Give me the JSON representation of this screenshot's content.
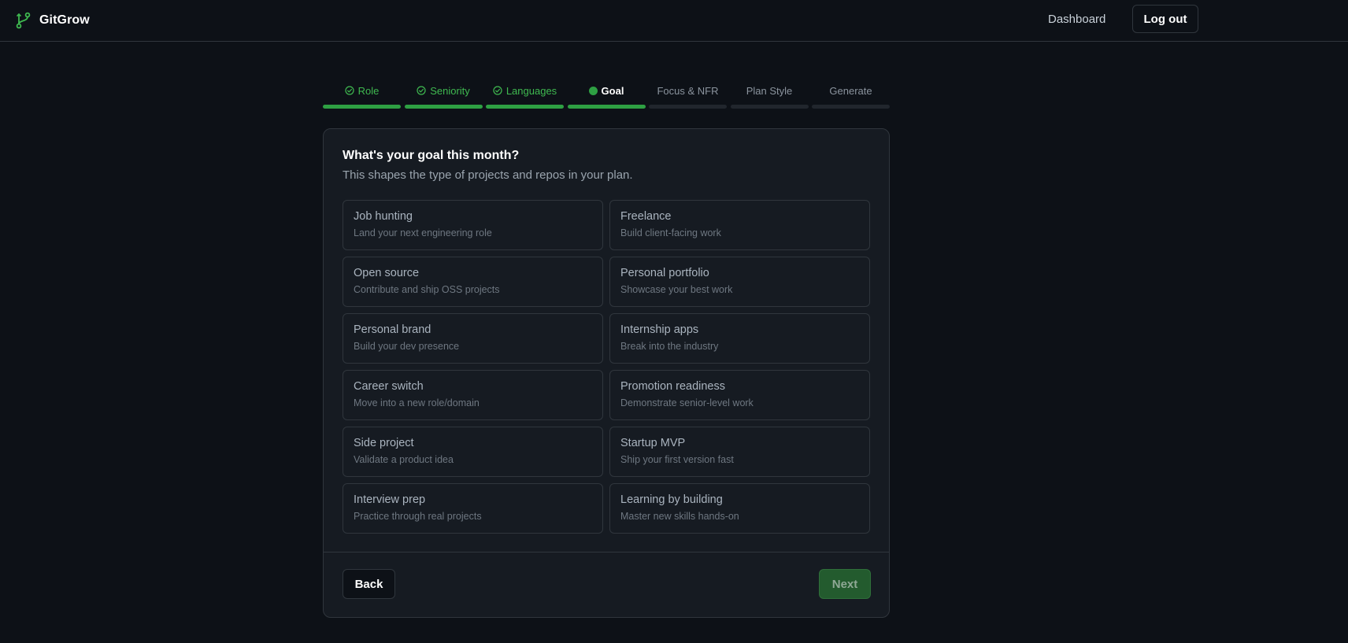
{
  "header": {
    "brand_name": "GitGrow",
    "brand_icon": "git-branch-icon",
    "nav_dashboard": "Dashboard",
    "logout_label": "Log out"
  },
  "stepper": {
    "steps": [
      {
        "label": "Role",
        "state": "done"
      },
      {
        "label": "Seniority",
        "state": "done"
      },
      {
        "label": "Languages",
        "state": "done"
      },
      {
        "label": "Goal",
        "state": "active"
      },
      {
        "label": "Focus & NFR",
        "state": "upcoming"
      },
      {
        "label": "Plan Style",
        "state": "upcoming"
      },
      {
        "label": "Generate",
        "state": "upcoming"
      }
    ]
  },
  "card": {
    "title": "What's your goal this month?",
    "subtitle": "This shapes the type of projects and repos in your plan.",
    "options": [
      {
        "title": "Job hunting",
        "desc": "Land your next engineering role"
      },
      {
        "title": "Freelance",
        "desc": "Build client-facing work"
      },
      {
        "title": "Open source",
        "desc": "Contribute and ship OSS projects"
      },
      {
        "title": "Personal portfolio",
        "desc": "Showcase your best work"
      },
      {
        "title": "Personal brand",
        "desc": "Build your dev presence"
      },
      {
        "title": "Internship apps",
        "desc": "Break into the industry"
      },
      {
        "title": "Career switch",
        "desc": "Move into a new role/domain"
      },
      {
        "title": "Promotion readiness",
        "desc": "Demonstrate senior-level work"
      },
      {
        "title": "Side project",
        "desc": "Validate a product idea"
      },
      {
        "title": "Startup MVP",
        "desc": "Ship your first version fast"
      },
      {
        "title": "Interview prep",
        "desc": "Practice through real projects"
      },
      {
        "title": "Learning by building",
        "desc": "Master new skills hands-on"
      }
    ],
    "back_label": "Back",
    "next_label": "Next"
  },
  "colors": {
    "background": "#0d1117",
    "surface": "#161b22",
    "border": "#30363d",
    "accent_green": "#2ea043",
    "done_text": "#3fb950"
  }
}
